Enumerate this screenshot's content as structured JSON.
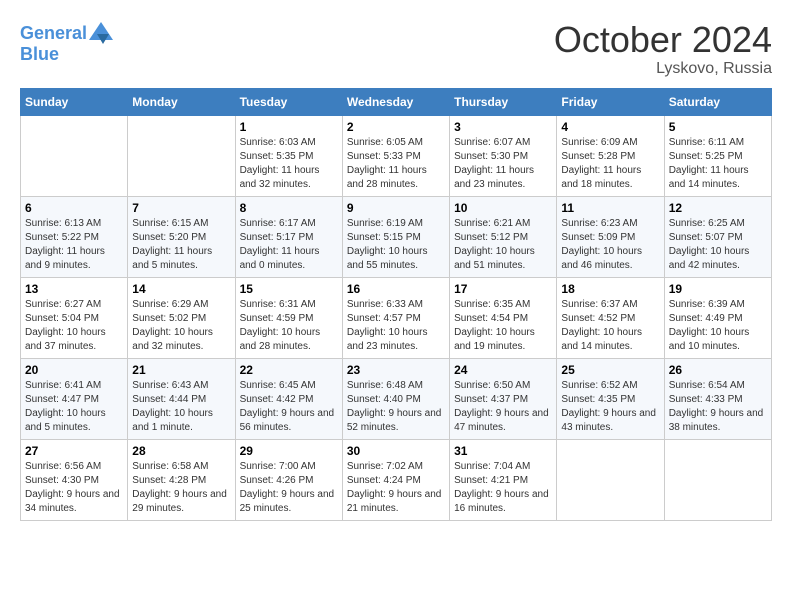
{
  "header": {
    "logo_line1": "General",
    "logo_line2": "Blue",
    "month": "October 2024",
    "location": "Lyskovo, Russia"
  },
  "weekdays": [
    "Sunday",
    "Monday",
    "Tuesday",
    "Wednesday",
    "Thursday",
    "Friday",
    "Saturday"
  ],
  "weeks": [
    [
      {
        "day": "",
        "sunrise": "",
        "sunset": "",
        "daylight": ""
      },
      {
        "day": "",
        "sunrise": "",
        "sunset": "",
        "daylight": ""
      },
      {
        "day": "1",
        "sunrise": "Sunrise: 6:03 AM",
        "sunset": "Sunset: 5:35 PM",
        "daylight": "Daylight: 11 hours and 32 minutes."
      },
      {
        "day": "2",
        "sunrise": "Sunrise: 6:05 AM",
        "sunset": "Sunset: 5:33 PM",
        "daylight": "Daylight: 11 hours and 28 minutes."
      },
      {
        "day": "3",
        "sunrise": "Sunrise: 6:07 AM",
        "sunset": "Sunset: 5:30 PM",
        "daylight": "Daylight: 11 hours and 23 minutes."
      },
      {
        "day": "4",
        "sunrise": "Sunrise: 6:09 AM",
        "sunset": "Sunset: 5:28 PM",
        "daylight": "Daylight: 11 hours and 18 minutes."
      },
      {
        "day": "5",
        "sunrise": "Sunrise: 6:11 AM",
        "sunset": "Sunset: 5:25 PM",
        "daylight": "Daylight: 11 hours and 14 minutes."
      }
    ],
    [
      {
        "day": "6",
        "sunrise": "Sunrise: 6:13 AM",
        "sunset": "Sunset: 5:22 PM",
        "daylight": "Daylight: 11 hours and 9 minutes."
      },
      {
        "day": "7",
        "sunrise": "Sunrise: 6:15 AM",
        "sunset": "Sunset: 5:20 PM",
        "daylight": "Daylight: 11 hours and 5 minutes."
      },
      {
        "day": "8",
        "sunrise": "Sunrise: 6:17 AM",
        "sunset": "Sunset: 5:17 PM",
        "daylight": "Daylight: 11 hours and 0 minutes."
      },
      {
        "day": "9",
        "sunrise": "Sunrise: 6:19 AM",
        "sunset": "Sunset: 5:15 PM",
        "daylight": "Daylight: 10 hours and 55 minutes."
      },
      {
        "day": "10",
        "sunrise": "Sunrise: 6:21 AM",
        "sunset": "Sunset: 5:12 PM",
        "daylight": "Daylight: 10 hours and 51 minutes."
      },
      {
        "day": "11",
        "sunrise": "Sunrise: 6:23 AM",
        "sunset": "Sunset: 5:09 PM",
        "daylight": "Daylight: 10 hours and 46 minutes."
      },
      {
        "day": "12",
        "sunrise": "Sunrise: 6:25 AM",
        "sunset": "Sunset: 5:07 PM",
        "daylight": "Daylight: 10 hours and 42 minutes."
      }
    ],
    [
      {
        "day": "13",
        "sunrise": "Sunrise: 6:27 AM",
        "sunset": "Sunset: 5:04 PM",
        "daylight": "Daylight: 10 hours and 37 minutes."
      },
      {
        "day": "14",
        "sunrise": "Sunrise: 6:29 AM",
        "sunset": "Sunset: 5:02 PM",
        "daylight": "Daylight: 10 hours and 32 minutes."
      },
      {
        "day": "15",
        "sunrise": "Sunrise: 6:31 AM",
        "sunset": "Sunset: 4:59 PM",
        "daylight": "Daylight: 10 hours and 28 minutes."
      },
      {
        "day": "16",
        "sunrise": "Sunrise: 6:33 AM",
        "sunset": "Sunset: 4:57 PM",
        "daylight": "Daylight: 10 hours and 23 minutes."
      },
      {
        "day": "17",
        "sunrise": "Sunrise: 6:35 AM",
        "sunset": "Sunset: 4:54 PM",
        "daylight": "Daylight: 10 hours and 19 minutes."
      },
      {
        "day": "18",
        "sunrise": "Sunrise: 6:37 AM",
        "sunset": "Sunset: 4:52 PM",
        "daylight": "Daylight: 10 hours and 14 minutes."
      },
      {
        "day": "19",
        "sunrise": "Sunrise: 6:39 AM",
        "sunset": "Sunset: 4:49 PM",
        "daylight": "Daylight: 10 hours and 10 minutes."
      }
    ],
    [
      {
        "day": "20",
        "sunrise": "Sunrise: 6:41 AM",
        "sunset": "Sunset: 4:47 PM",
        "daylight": "Daylight: 10 hours and 5 minutes."
      },
      {
        "day": "21",
        "sunrise": "Sunrise: 6:43 AM",
        "sunset": "Sunset: 4:44 PM",
        "daylight": "Daylight: 10 hours and 1 minute."
      },
      {
        "day": "22",
        "sunrise": "Sunrise: 6:45 AM",
        "sunset": "Sunset: 4:42 PM",
        "daylight": "Daylight: 9 hours and 56 minutes."
      },
      {
        "day": "23",
        "sunrise": "Sunrise: 6:48 AM",
        "sunset": "Sunset: 4:40 PM",
        "daylight": "Daylight: 9 hours and 52 minutes."
      },
      {
        "day": "24",
        "sunrise": "Sunrise: 6:50 AM",
        "sunset": "Sunset: 4:37 PM",
        "daylight": "Daylight: 9 hours and 47 minutes."
      },
      {
        "day": "25",
        "sunrise": "Sunrise: 6:52 AM",
        "sunset": "Sunset: 4:35 PM",
        "daylight": "Daylight: 9 hours and 43 minutes."
      },
      {
        "day": "26",
        "sunrise": "Sunrise: 6:54 AM",
        "sunset": "Sunset: 4:33 PM",
        "daylight": "Daylight: 9 hours and 38 minutes."
      }
    ],
    [
      {
        "day": "27",
        "sunrise": "Sunrise: 6:56 AM",
        "sunset": "Sunset: 4:30 PM",
        "daylight": "Daylight: 9 hours and 34 minutes."
      },
      {
        "day": "28",
        "sunrise": "Sunrise: 6:58 AM",
        "sunset": "Sunset: 4:28 PM",
        "daylight": "Daylight: 9 hours and 29 minutes."
      },
      {
        "day": "29",
        "sunrise": "Sunrise: 7:00 AM",
        "sunset": "Sunset: 4:26 PM",
        "daylight": "Daylight: 9 hours and 25 minutes."
      },
      {
        "day": "30",
        "sunrise": "Sunrise: 7:02 AM",
        "sunset": "Sunset: 4:24 PM",
        "daylight": "Daylight: 9 hours and 21 minutes."
      },
      {
        "day": "31",
        "sunrise": "Sunrise: 7:04 AM",
        "sunset": "Sunset: 4:21 PM",
        "daylight": "Daylight: 9 hours and 16 minutes."
      },
      {
        "day": "",
        "sunrise": "",
        "sunset": "",
        "daylight": ""
      },
      {
        "day": "",
        "sunrise": "",
        "sunset": "",
        "daylight": ""
      }
    ]
  ]
}
